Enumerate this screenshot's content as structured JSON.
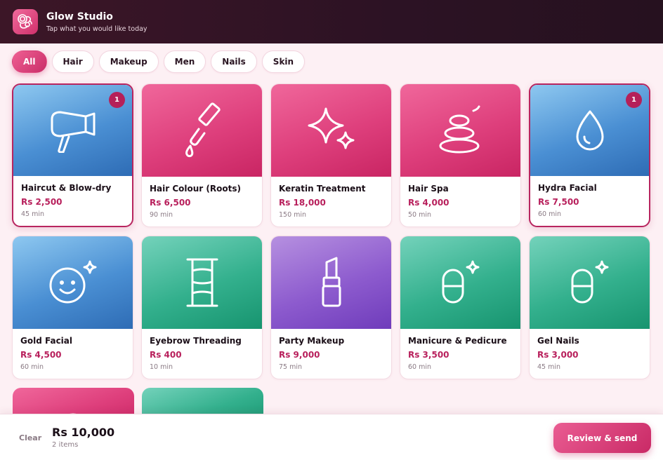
{
  "header": {
    "title": "Glow Studio",
    "subtitle": "Tap what you would like today",
    "logo_icon": "flower-logo-icon"
  },
  "filters": [
    {
      "label": "All",
      "active": true
    },
    {
      "label": "Hair",
      "active": false
    },
    {
      "label": "Makeup",
      "active": false
    },
    {
      "label": "Men",
      "active": false
    },
    {
      "label": "Nails",
      "active": false
    },
    {
      "label": "Skin",
      "active": false
    }
  ],
  "services": [
    {
      "name": "Haircut & Blow-dry",
      "price": "Rs 2,500",
      "duration": "45 min",
      "icon": "hair-dryer-icon",
      "color": "blue",
      "selected": true,
      "qty": "1"
    },
    {
      "name": "Hair Colour (Roots)",
      "price": "Rs 6,500",
      "duration": "90 min",
      "icon": "dye-brush-icon",
      "color": "pink",
      "selected": false
    },
    {
      "name": "Keratin Treatment",
      "price": "Rs 18,000",
      "duration": "150 min",
      "icon": "sparkle-icon",
      "color": "pink",
      "selected": false
    },
    {
      "name": "Hair Spa",
      "price": "Rs 4,000",
      "duration": "50 min",
      "icon": "spa-stones-icon",
      "color": "pink",
      "selected": false
    },
    {
      "name": "Hydra Facial",
      "price": "Rs 7,500",
      "duration": "60 min",
      "icon": "droplet-icon",
      "color": "blue",
      "selected": true,
      "qty": "1"
    },
    {
      "name": "Gold Facial",
      "price": "Rs 4,500",
      "duration": "60 min",
      "icon": "smile-sparkle-icon",
      "color": "blue",
      "selected": false
    },
    {
      "name": "Eyebrow Threading",
      "price": "Rs 400",
      "duration": "10 min",
      "icon": "thread-ladder-icon",
      "color": "green",
      "selected": false
    },
    {
      "name": "Party Makeup",
      "price": "Rs 9,000",
      "duration": "75 min",
      "icon": "lipstick-icon",
      "color": "purple",
      "selected": false
    },
    {
      "name": "Manicure & Pedicure",
      "price": "Rs 3,500",
      "duration": "60 min",
      "icon": "capsule-sparkle-icon",
      "color": "green",
      "selected": false
    },
    {
      "name": "Gel Nails",
      "price": "Rs 3,000",
      "duration": "45 min",
      "icon": "capsule-sparkle-icon",
      "color": "green",
      "selected": false
    }
  ],
  "partial_cards": [
    {
      "color": "pink"
    },
    {
      "color": "green"
    }
  ],
  "cart": {
    "clear_label": "Clear",
    "total": "Rs 10,000",
    "items": "2 items",
    "review_label": "Review & send"
  },
  "colors": {
    "accent": "#c92e68",
    "price": "#b8205c",
    "header": "#2c1224"
  }
}
